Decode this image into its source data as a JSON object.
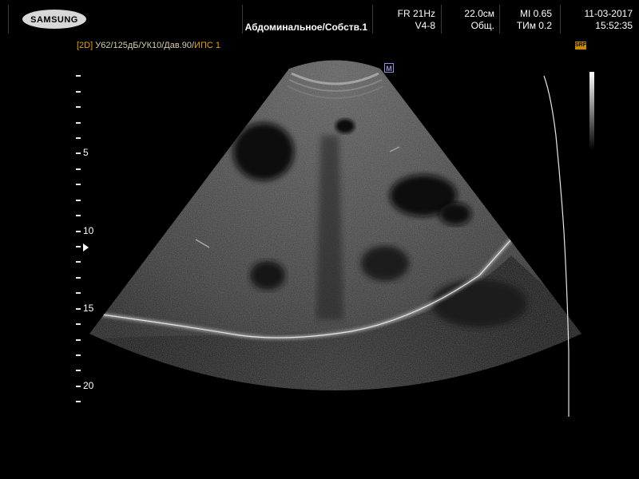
{
  "header": {
    "brand": "SAMSUNG",
    "preset": "Абдоминальное/Собств.1",
    "frame_rate": "FR 21Hz",
    "probe": "V4-8",
    "depth": "22.0см",
    "mode": "Общ.",
    "mi": "MI  0.65",
    "tim": "ТИм 0.2",
    "date": "11-03-2017",
    "time": "15:52:35"
  },
  "settings": {
    "mode_tag": "[2D]",
    "params": "У62/125дБ/УК10/Дав.90/",
    "ips": "ИПС 1",
    "srf_badge": "SRF"
  },
  "markers": {
    "orientation_mark": "M"
  },
  "depth_scale": {
    "unit_labels": [
      "5",
      "10",
      "15",
      "20"
    ]
  },
  "colors": {
    "background": "#000000",
    "text": "#ffffff",
    "settings_text": "#d7cfaa",
    "accent": "#e6a400",
    "marker": "#8c8cd9"
  },
  "icons": {
    "logo": "samsung-logo",
    "focus": "focus-triangle-icon",
    "orientation": "orientation-m-icon"
  }
}
